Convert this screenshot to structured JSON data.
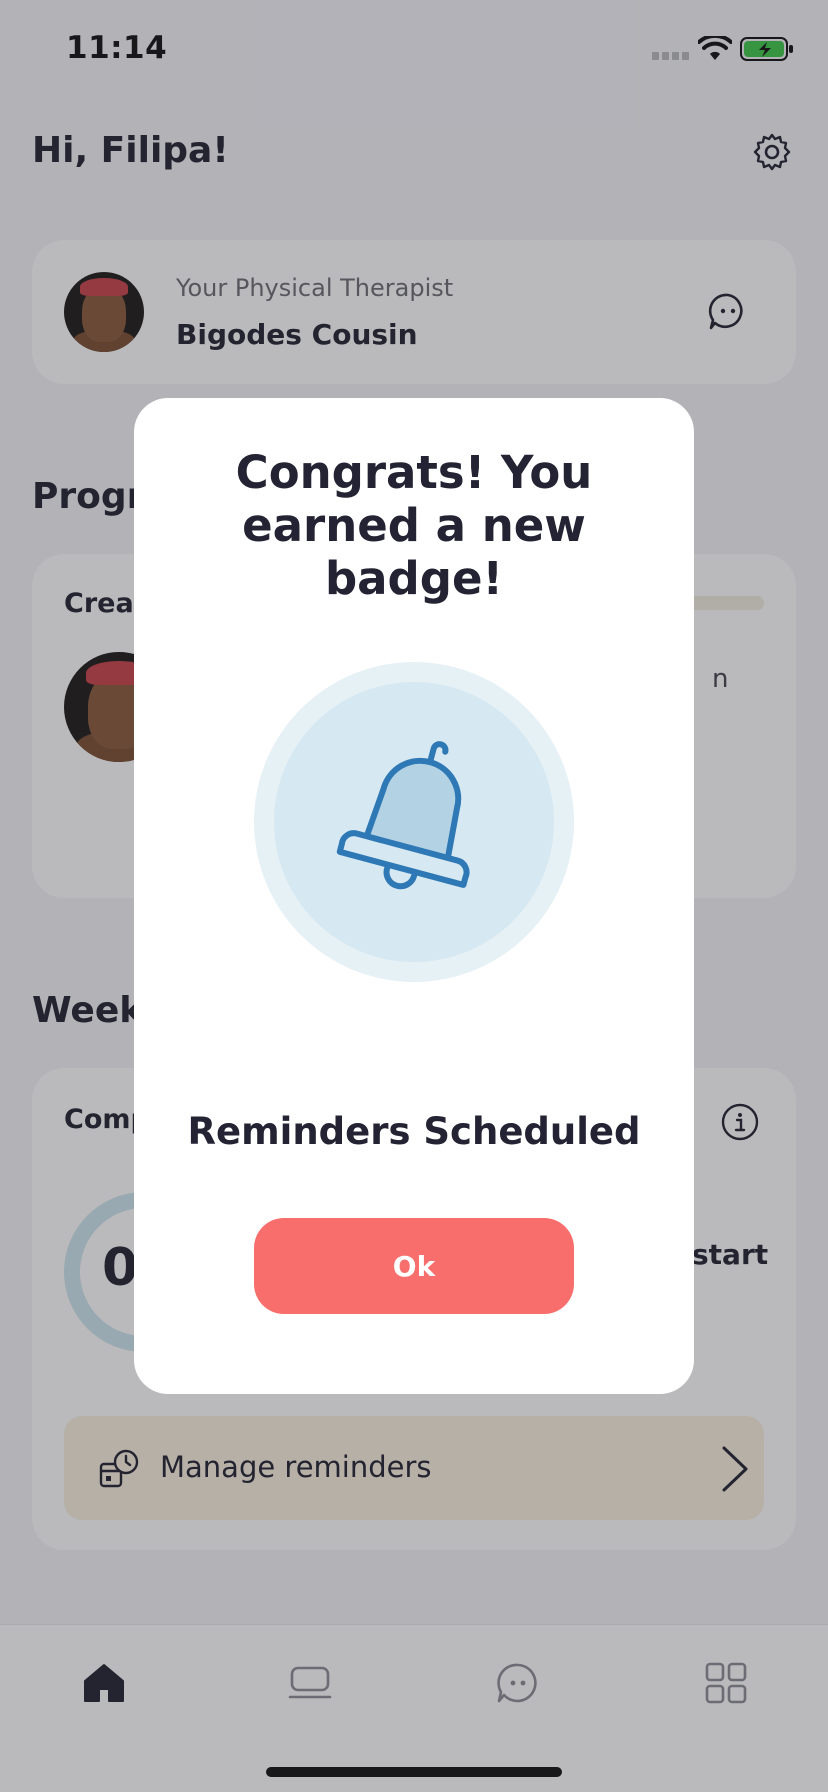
{
  "status_bar": {
    "time": "11:14"
  },
  "header": {
    "greeting": "Hi, Filipa!"
  },
  "therapist": {
    "role": "Your Physical Therapist",
    "name": "Bigodes Cousin"
  },
  "progress": {
    "section_title_visible": "Progr",
    "card_label_visible": "Creat",
    "text_visible": "n"
  },
  "weekly": {
    "section_title_visible": "Week",
    "card_label_visible": "Comp",
    "ring_value_visible": "0",
    "start_text_visible": "start"
  },
  "reminders": {
    "label": "Manage reminders"
  },
  "modal": {
    "title": "Congrats! You earned a new badge!",
    "badge_name": "Reminders Scheduled",
    "ok_label": "Ok",
    "badge_icon": "bell-icon"
  },
  "tabs": [
    {
      "icon": "home-icon",
      "active": true
    },
    {
      "icon": "sessions-icon",
      "active": false
    },
    {
      "icon": "chat-icon",
      "active": false
    },
    {
      "icon": "grid-icon",
      "active": false
    }
  ],
  "colors": {
    "accent": "#f76e6c",
    "badge_outer": "#e6f1f6",
    "badge_inner": "#d6e8f1",
    "badge_stroke": "#2e78b5",
    "text_primary": "#232333"
  }
}
